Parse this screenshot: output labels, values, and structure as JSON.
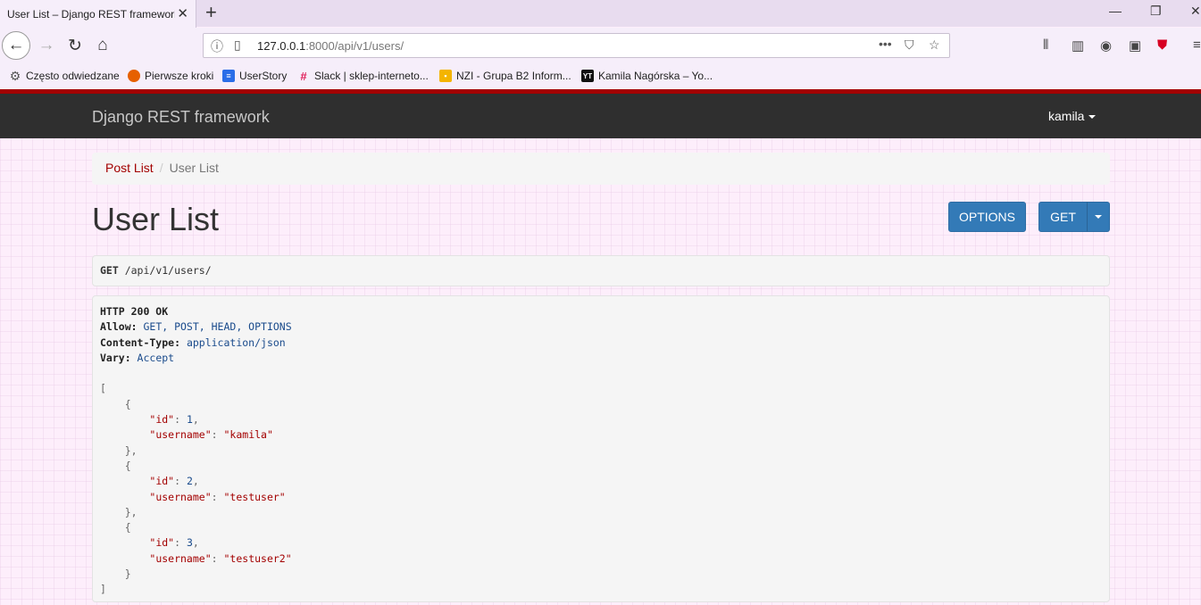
{
  "browser": {
    "tab_title": "User List – Django REST framework",
    "url_host": "127.0.0.1",
    "url_rest": ":8000/api/v1/users/",
    "bookmarks": [
      {
        "label": "Często odwiedzane",
        "icon": "gear-icon"
      },
      {
        "label": "Pierwsze kroki",
        "icon": "firefox-icon"
      },
      {
        "label": "UserStory",
        "icon": "doc-icon"
      },
      {
        "label": "Slack | sklep-interneto...",
        "icon": "slack-icon"
      },
      {
        "label": "NZI - Grupa B2 Inform...",
        "icon": "classroom-icon"
      },
      {
        "label": "Kamila Nagórska – Yo...",
        "icon": "yt-icon"
      }
    ]
  },
  "header": {
    "brand": "Django REST framework",
    "user": "kamila"
  },
  "breadcrumb": {
    "link": "Post List",
    "separator": "/",
    "active": "User List"
  },
  "page_title": "User List",
  "buttons": {
    "options": "OPTIONS",
    "get": "GET"
  },
  "request": {
    "method": "GET",
    "path": " /api/v1/users/"
  },
  "response": {
    "status": "HTTP 200 OK",
    "headers": [
      {
        "key": "Allow:",
        "value": " GET, POST, HEAD, OPTIONS"
      },
      {
        "key": "Content-Type:",
        "value": " application/json"
      },
      {
        "key": "Vary:",
        "value": " Accept"
      }
    ],
    "users": [
      {
        "id": "1",
        "username": "\"kamila\""
      },
      {
        "id": "2",
        "username": "\"testuser\""
      },
      {
        "id": "3",
        "username": "\"testuser2\""
      }
    ],
    "json_open": "[",
    "json_close": "]",
    "obj_open": "{",
    "obj_close": "}",
    "obj_close_comma": "},",
    "id_key": "\"id\"",
    "username_key": "\"username\"",
    "colon": ": ",
    "comma": ","
  },
  "colors": {
    "accent": "#a30000",
    "button": "#337ab7",
    "topbar": "#2f2f2f"
  }
}
